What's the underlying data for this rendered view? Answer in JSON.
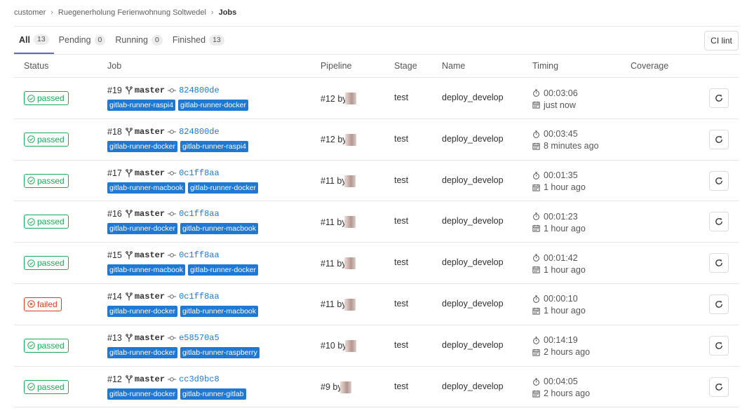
{
  "breadcrumb": {
    "items": [
      "customer",
      "Ruegenerholung Ferienwohnung Soltwedel"
    ],
    "separator": "›",
    "current": "Jobs"
  },
  "tabs": [
    {
      "label": "All",
      "count": "13"
    },
    {
      "label": "Pending",
      "count": "0"
    },
    {
      "label": "Running",
      "count": "0"
    },
    {
      "label": "Finished",
      "count": "13"
    }
  ],
  "ci_lint_label": "CI lint",
  "columns": {
    "status": "Status",
    "job": "Job",
    "pipeline": "Pipeline",
    "stage": "Stage",
    "name": "Name",
    "timing": "Timing",
    "coverage": "Coverage"
  },
  "colors": {
    "passed": "#1aaa55",
    "failed": "#db3b21",
    "tag": "#1f78d1",
    "link": "#1f78d1"
  },
  "icons": {
    "status_passed": "check-circle-icon",
    "status_failed": "close-circle-icon",
    "branch": "branch-icon",
    "commit": "commit-icon",
    "duration": "timer-icon",
    "finished": "calendar-icon",
    "retry": "retry-icon"
  },
  "jobs": [
    {
      "status": "passed",
      "id": "#19",
      "branch": "master",
      "commit": "824800de",
      "tags": [
        "gitlab-runner-raspi4",
        "gitlab-runner-docker"
      ],
      "pipeline": "#12 by",
      "stage": "test",
      "name": "deploy_develop",
      "duration": "00:03:06",
      "finished": "just now"
    },
    {
      "status": "passed",
      "id": "#18",
      "branch": "master",
      "commit": "824800de",
      "tags": [
        "gitlab-runner-docker",
        "gitlab-runner-raspi4"
      ],
      "pipeline": "#12 by",
      "stage": "test",
      "name": "deploy_develop",
      "duration": "00:03:45",
      "finished": "8 minutes ago"
    },
    {
      "status": "passed",
      "id": "#17",
      "branch": "master",
      "commit": "0c1ff8aa",
      "tags": [
        "gitlab-runner-macbook",
        "gitlab-runner-docker"
      ],
      "pipeline": "#11 by",
      "stage": "test",
      "name": "deploy_develop",
      "duration": "00:01:35",
      "finished": "1 hour ago"
    },
    {
      "status": "passed",
      "id": "#16",
      "branch": "master",
      "commit": "0c1ff8aa",
      "tags": [
        "gitlab-runner-docker",
        "gitlab-runner-macbook"
      ],
      "pipeline": "#11 by",
      "stage": "test",
      "name": "deploy_develop",
      "duration": "00:01:23",
      "finished": "1 hour ago"
    },
    {
      "status": "passed",
      "id": "#15",
      "branch": "master",
      "commit": "0c1ff8aa",
      "tags": [
        "gitlab-runner-macbook",
        "gitlab-runner-docker"
      ],
      "pipeline": "#11 by",
      "stage": "test",
      "name": "deploy_develop",
      "duration": "00:01:42",
      "finished": "1 hour ago"
    },
    {
      "status": "failed",
      "id": "#14",
      "branch": "master",
      "commit": "0c1ff8aa",
      "tags": [
        "gitlab-runner-docker",
        "gitlab-runner-macbook"
      ],
      "pipeline": "#11 by",
      "stage": "test",
      "name": "deploy_develop",
      "duration": "00:00:10",
      "finished": "1 hour ago"
    },
    {
      "status": "passed",
      "id": "#13",
      "branch": "master",
      "commit": "e58570a5",
      "tags": [
        "gitlab-runner-docker",
        "gitlab-runner-raspberry"
      ],
      "pipeline": "#10 by",
      "stage": "test",
      "name": "deploy_develop",
      "duration": "00:14:19",
      "finished": "2 hours ago"
    },
    {
      "status": "passed",
      "id": "#12",
      "branch": "master",
      "commit": "cc3d9bc8",
      "tags": [
        "gitlab-runner-docker",
        "gitlab-runner-gitlab"
      ],
      "pipeline": "#9 by",
      "stage": "test",
      "name": "deploy_develop",
      "duration": "00:04:05",
      "finished": "2 hours ago"
    }
  ]
}
